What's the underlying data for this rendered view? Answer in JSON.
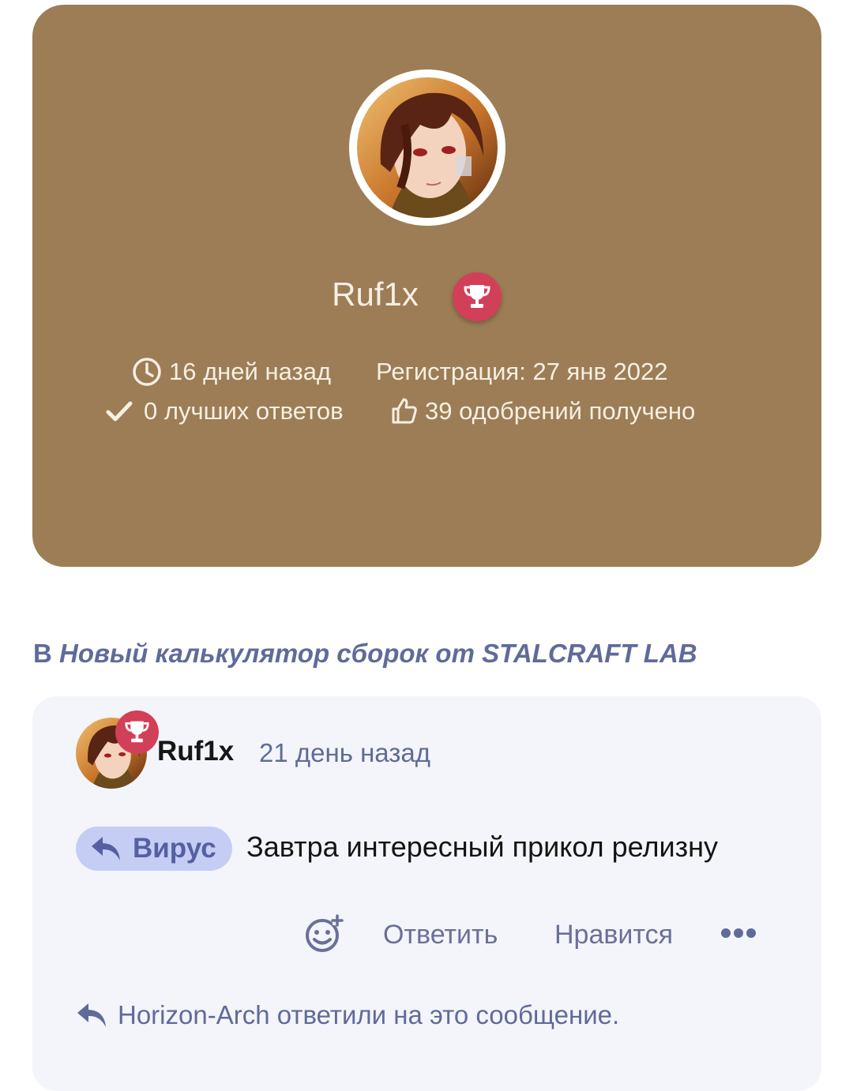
{
  "profile": {
    "username": "Ruf1x",
    "last_seen": "16 дней назад",
    "registration": "Регистрация: 27 янв 2022",
    "best_answers": "0 лучших ответов",
    "likes_received": "39 одобрений получено",
    "card_color": "#9c7d55",
    "badge_icon": "trophy-icon"
  },
  "thread": {
    "prefix": "В",
    "title": "Новый калькулятор сборок от STALCRAFT LAB"
  },
  "comment": {
    "author": "Ruf1x",
    "time": "21 день назад",
    "reply_to": "Вирус",
    "text": "Завтра интересный прикол релизну",
    "actions": {
      "reply": "Ответить",
      "like": "Нравится"
    },
    "reply_note": "Horizon-Arch ответили на это сообщение."
  }
}
